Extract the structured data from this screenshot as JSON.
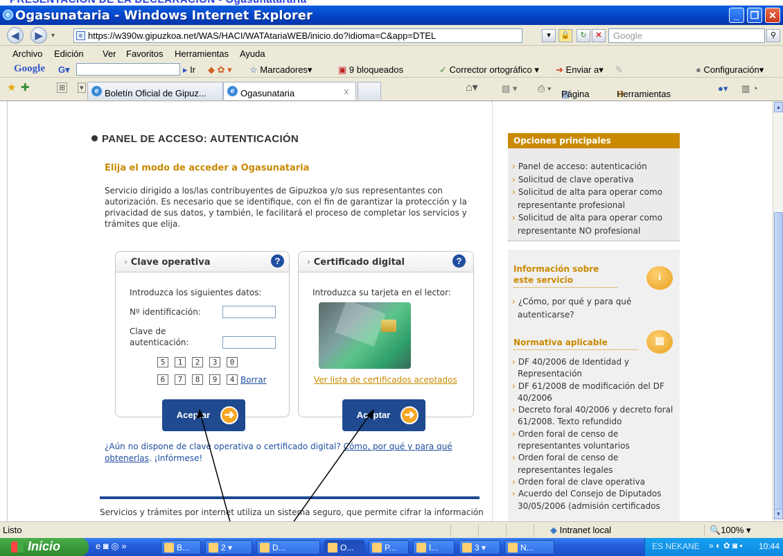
{
  "window": {
    "top_cut_text": "PRESENTACIÓN DE LA DECLARACIÓN - Ogasunatararia",
    "title": "Ogasunataria - Windows Internet Explorer"
  },
  "address": {
    "url": "https://w390w.gipuzkoa.net/WAS/HACI/WATAtariaWEB/inicio.do?idioma=C&app=DTEL",
    "search_placeholder": "Google"
  },
  "menu": [
    "Archivo",
    "Edición",
    "Ver",
    "Favoritos",
    "Herramientas",
    "Ayuda"
  ],
  "google_toolbar": {
    "logo": "Google",
    "go": "Ir",
    "bookmarks": "Marcadores▾",
    "blocked": "9 bloqueados",
    "spell": "Corrector ortográfico ▾",
    "send": "Enviar a▾",
    "settings": "Configuración▾"
  },
  "tabs": {
    "tab1": "Boletín Oficial de Gipuz...",
    "tab2": "Ogasunataria",
    "close": "x",
    "page": "Página ▾",
    "tools": "Herramientas ▾"
  },
  "page": {
    "title": "PANEL DE ACCESO: AUTENTICACIÓN",
    "subtitle": "Elija el modo de acceder a Ogasunataria",
    "intro": "Servicio dirigido a los/las contribuyentes de Gipuzkoa y/o sus representantes con autorización. Es necesario que se identifique, con el fin de garantizar la protección y la privacidad de sus datos, y también, le facilitará el proceso de completar los servicios y trámites que elija.",
    "clave": {
      "header": "Clave operativa",
      "instructions": "Introduzca los siguientes datos:",
      "id_label": "Nº identificación:",
      "auth_label1": "Clave de",
      "auth_label2": "autenticación:",
      "keys_row1": [
        "5",
        "1",
        "2",
        "3",
        "0"
      ],
      "keys_row2": [
        "6",
        "7",
        "8",
        "9",
        "4"
      ],
      "clear": "Borrar",
      "accept": "Aceptar"
    },
    "cert": {
      "header": "Certificado digital",
      "instructions": "Introduzca su tarjeta en el lector:",
      "list_link": "Ver lista de certificados aceptados",
      "accept": "Aceptar"
    },
    "help_text": "¿Aún no dispone de clave operativa o certificado digital?",
    "help_link": "Cómo, por qué y para qué obtenerlas",
    "help_tail": ". ¡Infórmese!",
    "bottom_text": "Servicios y trámites por internet utiliza un sistema seguro, que permite cifrar la información"
  },
  "sidebar": {
    "main_header": "Opciones principales",
    "main_items": [
      "Panel de acceso: autenticación",
      "Solicitud de clave operativa",
      "Solicitud de alta para operar como representante profesional",
      "Solicitud de alta para operar como representante NO profesional"
    ],
    "info_title": "Información sobre este servicio",
    "info_items": [
      "¿Cómo, por qué y para qué autenticarse?"
    ],
    "norm_title": "Normativa aplicable",
    "norm_items": [
      "DF 40/2006 de Identidad y Representación",
      "DF 61/2008 de modificación del DF 40/2006",
      "Decreto foral 40/2006 y decreto foral 61/2008. Texto refundido",
      "Orden foral de censo de representantes voluntarios",
      "Orden foral de censo de representantes legales",
      "Orden foral de clave operativa",
      "Acuerdo del Consejo de Diputados 30/05/2006 (admisión certificados"
    ]
  },
  "status": {
    "left": "Listo",
    "zone": "Intranet local",
    "zoom": "100%"
  },
  "taskbar": {
    "start": "Inicio",
    "buttons": [
      "B...",
      "2",
      "D...",
      "O...",
      "P...",
      "I...",
      "3",
      "N..."
    ],
    "tray_text": "ES NEKANE",
    "time": "10:44"
  }
}
